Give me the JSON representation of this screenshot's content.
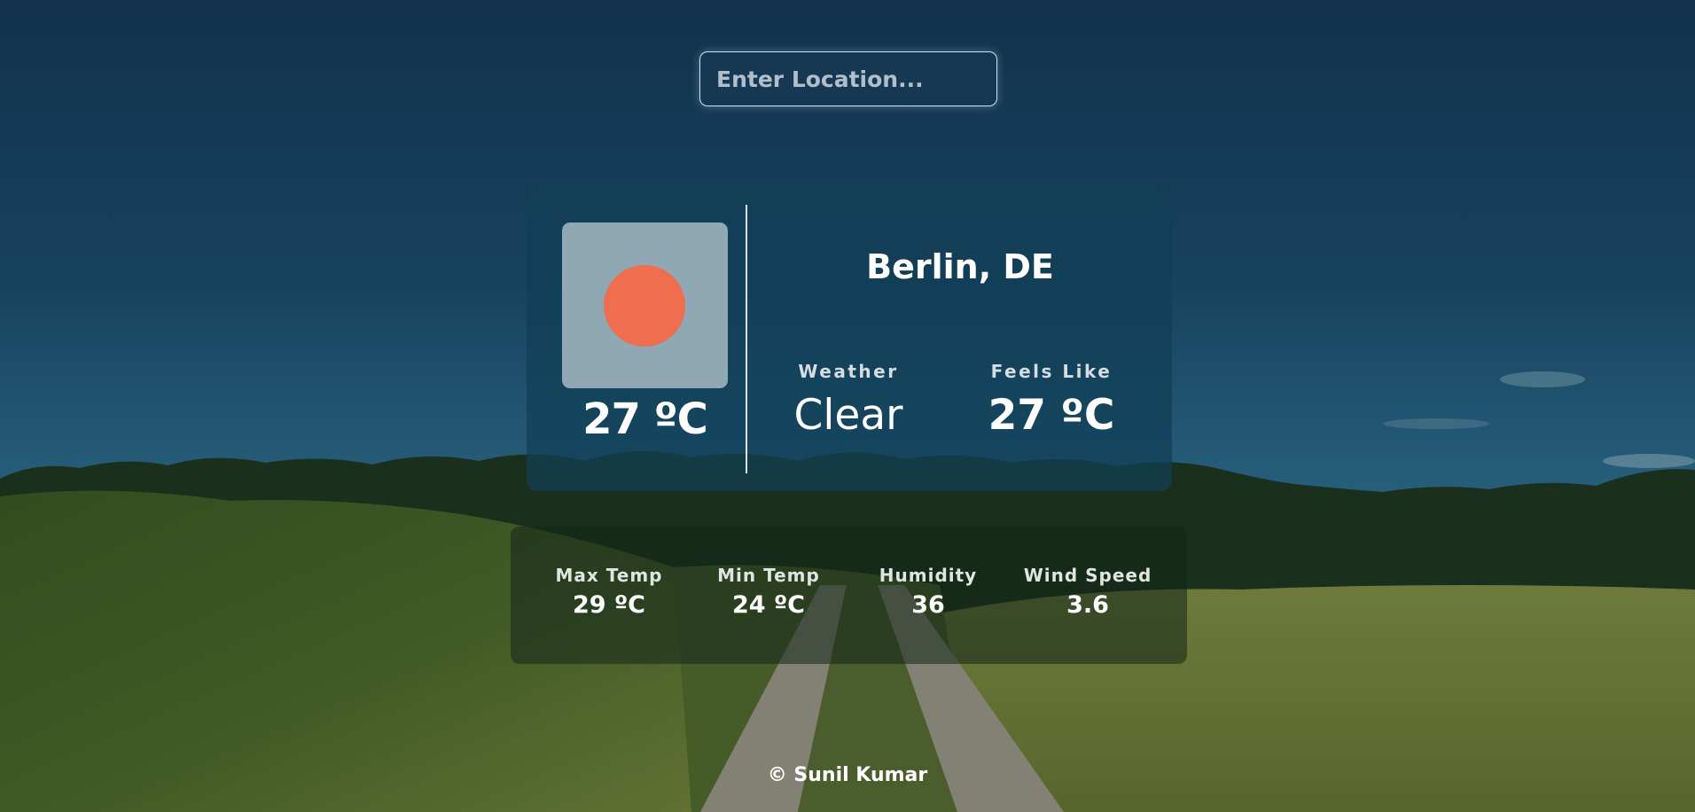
{
  "search": {
    "placeholder": "Enter Location...",
    "value": ""
  },
  "current": {
    "icon": "clear-sun-icon",
    "icon_color": "#ee6e4e",
    "temperature": "27 ºC",
    "location": "Berlin, DE",
    "weather_label": "Weather",
    "weather_value": "Clear",
    "feels_like_label": "Feels Like",
    "feels_like_value": "27 ºC"
  },
  "details": [
    {
      "label": "Max Temp",
      "value": "29 ºC"
    },
    {
      "label": "Min Temp",
      "value": "24 ºC"
    },
    {
      "label": "Humidity",
      "value": "36"
    },
    {
      "label": "Wind Speed",
      "value": "3.6"
    }
  ],
  "footer": {
    "credit": "© Sunil Kumar"
  }
}
